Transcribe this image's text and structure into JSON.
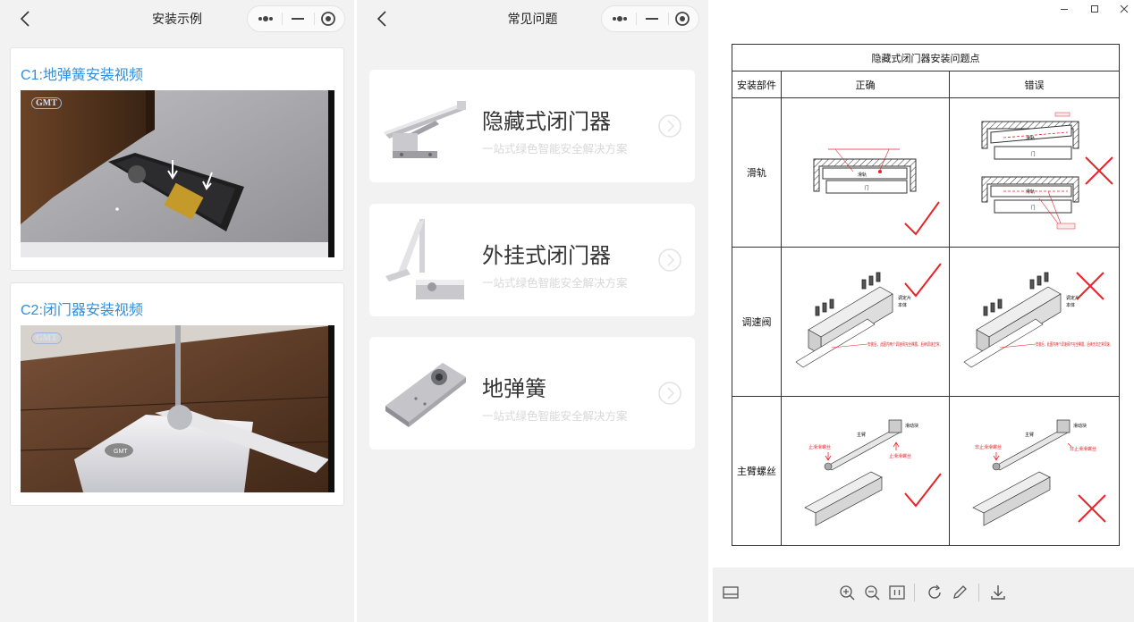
{
  "panel1": {
    "title": "安装示例",
    "videos": [
      {
        "title": "C1:地弹簧安装视频",
        "watermark": "GMT"
      },
      {
        "title": "C2:闭门器安装视频",
        "watermark": "GMT"
      }
    ]
  },
  "panel2": {
    "title": "常见问题",
    "products": [
      {
        "name": "隐藏式闭门器",
        "subtitle": "一站式绿色智能安全解决方案"
      },
      {
        "name": "外挂式闭门器",
        "subtitle": "一站式绿色智能安全解决方案"
      },
      {
        "name": "地弹簧",
        "subtitle": "一站式绿色智能安全解决方案"
      }
    ]
  },
  "panel3": {
    "doc_title": "隐藏式闭门器安装问题点",
    "headers": [
      "安装部件",
      "正确",
      "错误"
    ],
    "rows": [
      {
        "part": "滑轨"
      },
      {
        "part": "调速阀"
      },
      {
        "part": "主臂螺丝"
      }
    ],
    "drawing_labels": {
      "slide_correct": "滑轨",
      "door": "门",
      "door2": "门",
      "door3": "门",
      "slide_wrong": "滑轨",
      "slide_wrong2": "滑轨",
      "valve_note_ok": "安装后，此图内两个调速阀完全裸露，后续调速正常。",
      "valve_note_bad": "安装后，此图内两个调速阀不完全裸露，后续无法正常调速。",
      "valve_lbl1": "调定片",
      "valve_lbl2": "本体",
      "valve_lbl1b": "调定片",
      "valve_lbl2b": "本体",
      "arm_main": "主臂",
      "arm_slider": "滑动块",
      "arm_stop": "止滑滑螺丝",
      "arm_stop2": "止滑滑螺丝",
      "arm_main_b": "主臂",
      "arm_slider_b": "滑动块",
      "arm_bad1": "非止滑滑螺丝",
      "arm_bad2": "非止滑滑螺丝"
    }
  },
  "colors": {
    "accent_blue": "#2d8fe0",
    "mark_red": "#e8242a"
  }
}
